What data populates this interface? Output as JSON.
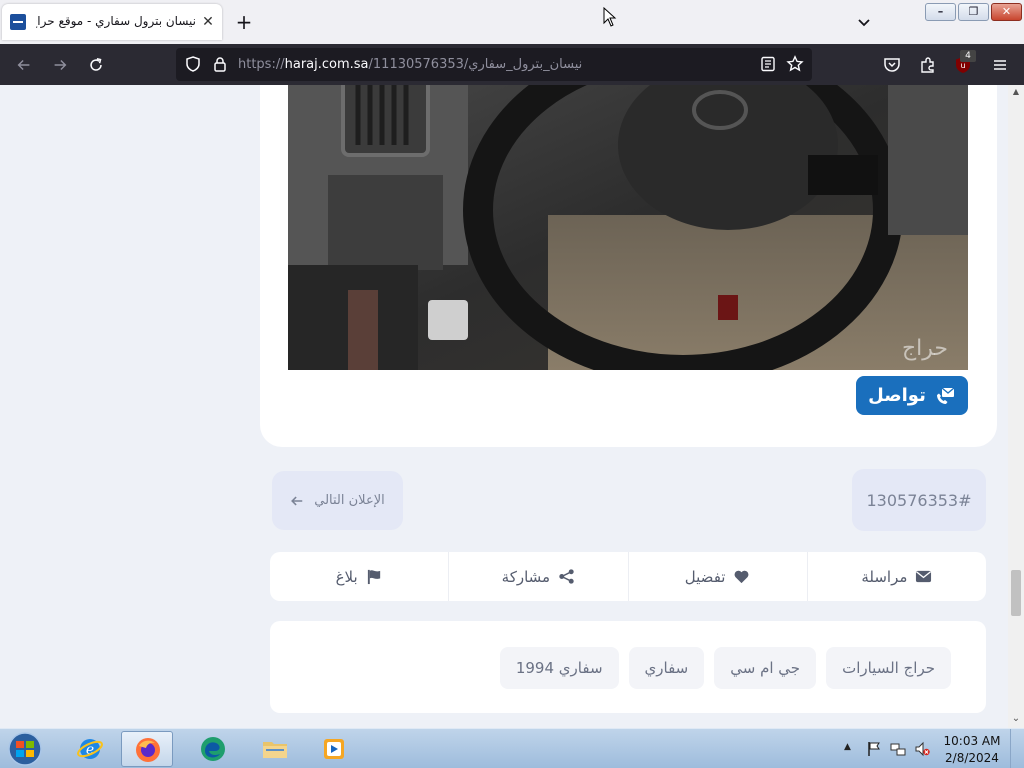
{
  "browser": {
    "tab_title": "نيسان بترول سفاري - موقع حراج",
    "url_prefix": "https://",
    "url_domain": "haraj.com.sa",
    "url_path": "/11130576353/نيسان_بترول_سفاري",
    "extension_badge": "4"
  },
  "post": {
    "contact_label": "تواصل",
    "image_watermark": "حراج"
  },
  "navigation": {
    "next_label": "الإعلان التالي",
    "post_id": "130576353#"
  },
  "actions": [
    {
      "label": "مراسلة",
      "icon": "envelope-icon"
    },
    {
      "label": "تفضيل",
      "icon": "heart-icon"
    },
    {
      "label": "مشاركة",
      "icon": "share-icon"
    },
    {
      "label": "بلاغ",
      "icon": "flag-icon"
    }
  ],
  "tags": [
    "حراج السيارات",
    "جي ام سي",
    "سفاري",
    "سفاري 1994"
  ],
  "taskbar": {
    "time": "10:03 AM",
    "date": "2/8/2024"
  },
  "colors": {
    "accent": "#1a6fbd",
    "page_bg": "#eef1f7",
    "chip_bg": "#e4e8f6"
  }
}
